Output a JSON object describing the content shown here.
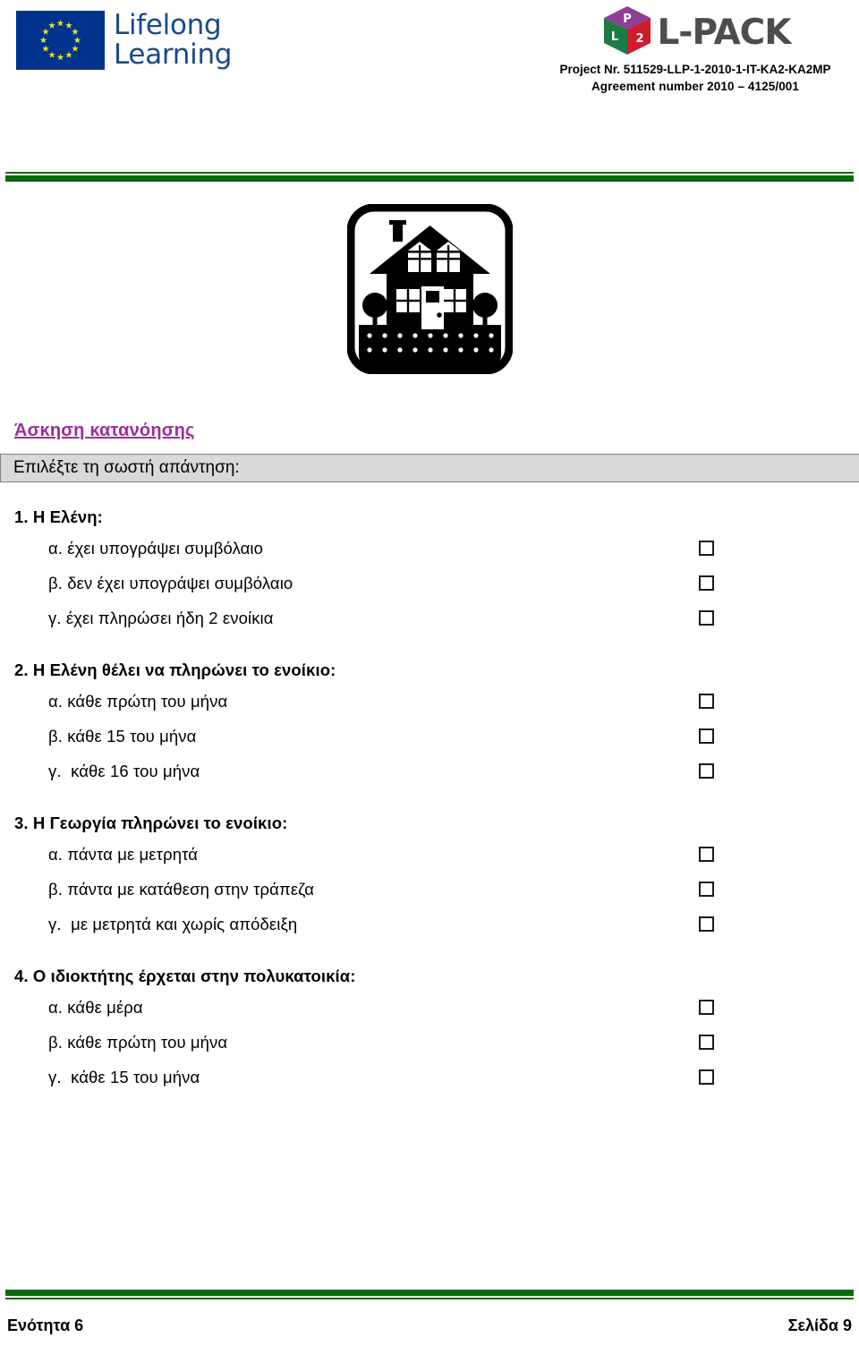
{
  "header": {
    "eu_logo_alt": "European Union flag",
    "lifelong_learning": "Lifelong\nLearning",
    "lpack_wordmark": "L-PACK",
    "cube_faces": {
      "top": "P",
      "left": "L",
      "right": "2"
    },
    "project_number": "Project Nr. 511529-LLP-1-2010-1-IT-KA2-KA2MP",
    "agreement_number": "Agreement number 2010 – 4125/001"
  },
  "colors": {
    "rule_green": "#0a6b0a",
    "heading_purple": "#9c2d9c",
    "instruction_bar_grey": "#d9d9d9",
    "eu_blue": "#00338e",
    "eu_star_yellow": "#f4e11a",
    "lifelong_navy": "#1b4a85",
    "cube_top_purple": "#8e3f96",
    "cube_left_green": "#1c7a45",
    "cube_right_red": "#cf1b2b",
    "lpack_grey": "#4d4d4d"
  },
  "illustration": {
    "name": "house-pictogram",
    "caption": ""
  },
  "main": {
    "section_heading": "Άσκηση κατανόησης",
    "instruction": "Επιλέξτε τη σωστή απάντηση:",
    "questions": [
      {
        "title": "1. Η Ελένη:",
        "options": [
          "α. έχει υπογράψει συμβόλαιο",
          "β. δεν έχει υπογράψει συμβόλαιο",
          "γ. έχει πληρώσει ήδη 2 ενοίκια"
        ]
      },
      {
        "title": "2. Η Ελένη θέλει να πληρώνει το ενοίκιο:",
        "options": [
          "α. κάθε πρώτη του μήνα",
          "β. κάθε 15 του μήνα",
          "γ.  κάθε 16 του μήνα"
        ]
      },
      {
        "title": "3. Η Γεωργία πληρώνει το ενοίκιο:",
        "options": [
          "α. πάντα με μετρητά",
          "β. πάντα με κατάθεση στην τράπεζα",
          "γ.  με μετρητά και χωρίς απόδειξη"
        ]
      },
      {
        "title": "4. Ο ιδιοκτήτης έρχεται  στην πολυκατοικία:",
        "options": [
          "α. κάθε μέρα",
          "β. κάθε πρώτη του μήνα",
          "γ.  κάθε 15 του μήνα"
        ]
      }
    ]
  },
  "footer": {
    "unit": "Ενότητα 6",
    "page": "Σελίδα 9"
  }
}
